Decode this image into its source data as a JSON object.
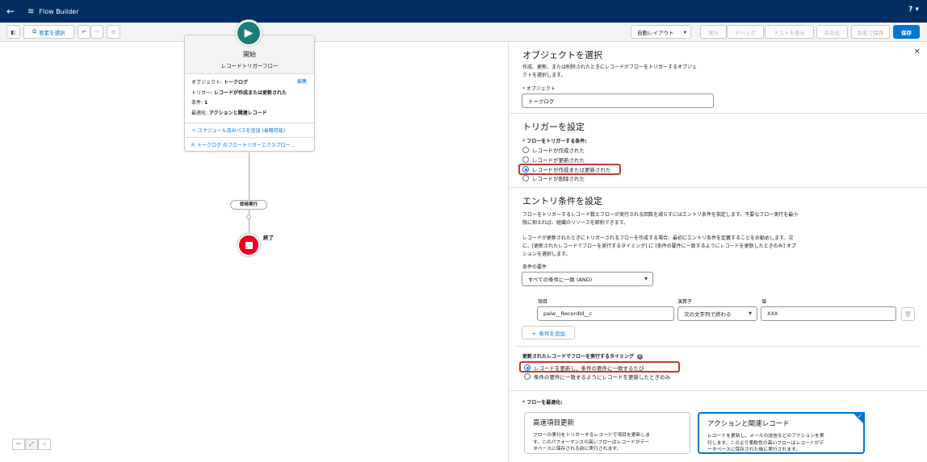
{
  "app": {
    "title": "Flow Builder",
    "help": "?"
  },
  "toolbar": {
    "select_elements": "要素を選択",
    "auto_layout": "自動レイアウト",
    "run": "実行",
    "debug": "デバッグ",
    "view_tests": "テストを表示",
    "activate": "有効化",
    "save_as": "別名で保存",
    "save": "保存"
  },
  "canvas": {
    "start": {
      "title": "開始",
      "subtitle": "レコードトリガーフロー",
      "object_label": "オブジェクト:",
      "object_value": "トークログ",
      "trigger_label": "トリガー:",
      "trigger_value": "レコードが作成または更新された",
      "conditions_label": "条件:",
      "conditions_value": "1",
      "optimize_label": "最適化:",
      "optimize_value": "アクションと関連レコード",
      "edit": "編集",
      "add_schedule": "スケジュール済みパスを追加 (省略可能)",
      "explorer": "トークログ のフロートリガーエクスプロー..."
    },
    "immediate": "即時実行",
    "end": "終了"
  },
  "panel": {
    "object_section": {
      "title": "オブジェクトを選択",
      "desc1": "作成、更新、または削除されたときにレコードがフローをトリガーするオブジェ",
      "desc2": "クトを選択します。",
      "object_label": "オブジェクト",
      "object_value": "トークログ"
    },
    "trigger_section": {
      "title": "トリガーを設定",
      "label": "フローをトリガーする条件:",
      "options": [
        "レコードが作成された",
        "レコードが更新された",
        "レコードが作成または更新された",
        "レコードが削除された"
      ]
    },
    "entry_section": {
      "title": "エントリ条件を設定",
      "desc1": "フローをトリガーするレコード数とフローが実行される回数を減らすにはエントリ条件を指定します。不要なフロー実行を最小",
      "desc2": "限に抑えれば、組織のリソースを節約できます。",
      "desc3": "レコードが更新されたときにトリガーされるフローを作成する場合、最初にエントリ条件を定義することをお勧めします。次",
      "desc4": "に、[更新されたレコードでフローを実行するタイミング] に [条件の要件に一致するようにレコードを更新したときのみ] オプ",
      "desc5": "ションを選択します。",
      "req_label": "条件の要件",
      "req_value": "すべての条件に一致 (AND)",
      "field_label": "項目",
      "field_value": "palw__RecordId__c",
      "operator_label": "演算子",
      "operator_value": "次の文字列で終わる",
      "value_label": "値",
      "value_value": "XXX",
      "add_condition": "条件を追加"
    },
    "timing_section": {
      "title": "更新されたレコードでフローを実行するタイミング",
      "options": [
        "レコードを更新し、条件の要件に一致するたび",
        "条件の要件に一致するようにレコードを更新したときのみ"
      ]
    },
    "optimize_section": {
      "label": "フローを最適化:",
      "fast": {
        "title": "高速項目更新",
        "d1": "フローの実行をトリガーするレコードで項目を更新しま",
        "d2": "す。このパフォーマンスの高いフローはレコードがデー",
        "d3": "タベースに保存される前に実行されます。"
      },
      "actions": {
        "title": "アクションと関連レコード",
        "d1": "レコードを更新し、メールの送信などのアクションを実",
        "d2": "行します。このより柔軟性の高いフローはレコードがデ",
        "d3": "ータベースに保存された後に実行されます。"
      }
    }
  }
}
